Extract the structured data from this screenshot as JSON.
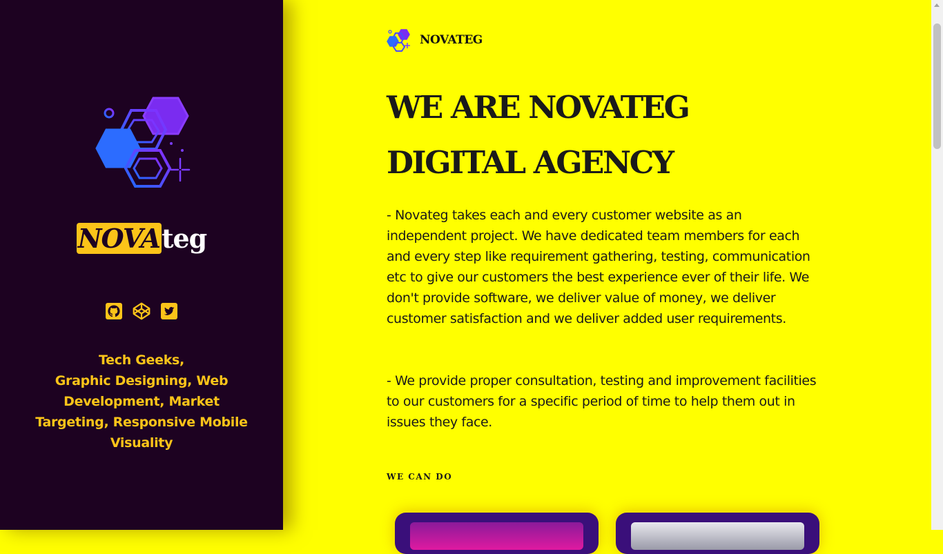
{
  "sidebar": {
    "logo_icon": "hexagon-cluster-logo",
    "brand": {
      "highlight": "NOVA",
      "rest": "teg"
    },
    "social": [
      {
        "name": "github-icon",
        "label": "GitHub"
      },
      {
        "name": "codepen-icon",
        "label": "CodePen"
      },
      {
        "name": "twitter-icon",
        "label": "Twitter"
      }
    ],
    "tagline_line1": "Tech Geeks,",
    "tagline_line2": "Graphic Designing, Web Development, Market Targeting, Responsive Mobile Visuality"
  },
  "header": {
    "logo_icon": "hexagon-cluster-mini-logo",
    "name": "NOVATEG"
  },
  "main": {
    "headline": "WE ARE NOVATEG DIGITAL AGENCY",
    "paragraph1": "- Novateg takes each and every customer website as an independent project. We have dedicated team members for each and every step like requirement gathering, testing, communication etc to give our customers the best experience ever of their life. We don't provide software, we deliver value of money, we deliver customer satisfaction and we deliver added user requirements.",
    "paragraph2": "- We provide proper consultation, testing and improvement facilities to our customers for a specific period of time to help them out in issues they face.",
    "section_label": "WE CAN DO"
  },
  "colors": {
    "page_bg": "#ffff00",
    "sidebar_bg": "#1d0221",
    "accent": "#fcc419",
    "card_bg": "#3a0f7a"
  }
}
